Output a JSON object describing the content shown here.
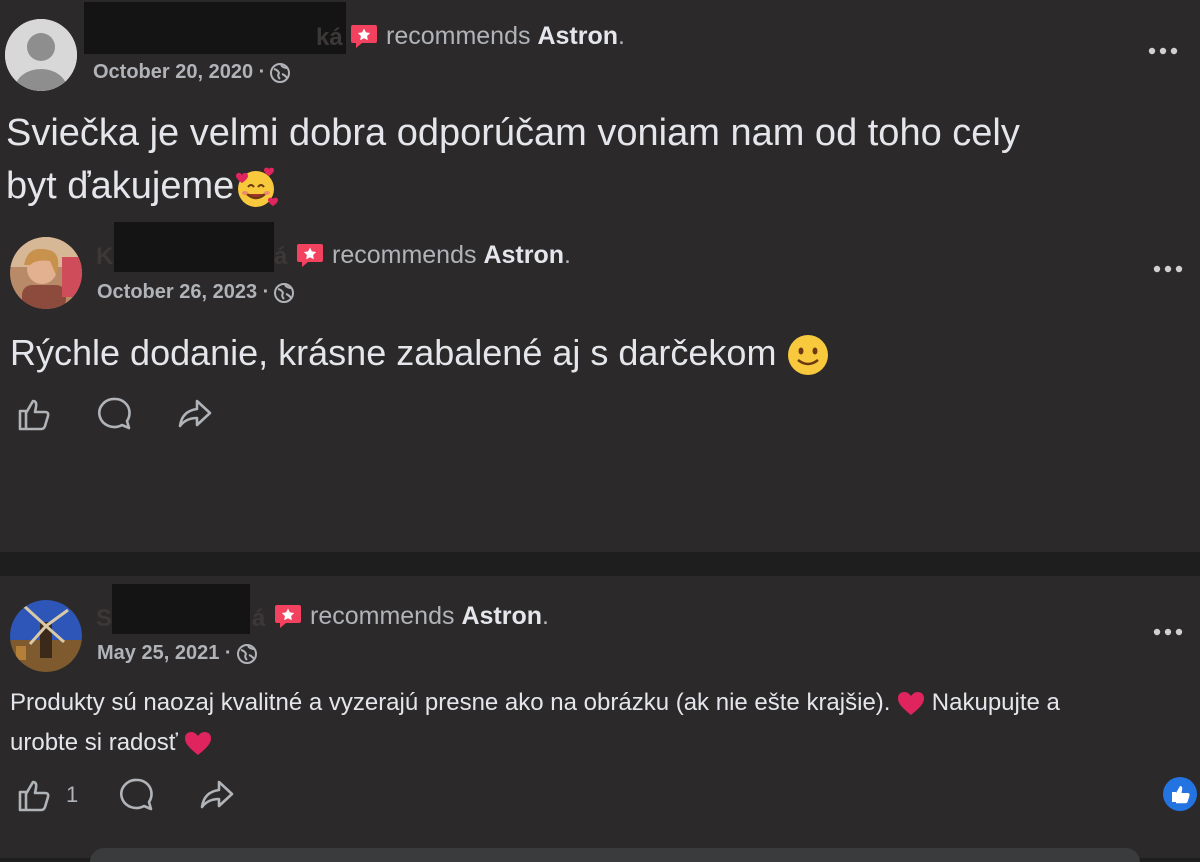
{
  "posts": [
    {
      "name_fragment": "ká",
      "recommends_text": "recommends",
      "page_name": "Astron",
      "period": ".",
      "date": "October 20, 2020 ·",
      "text_line1": "Sviečka je velmi dobra odporúčam voniam nam od toho cely",
      "text_line2": "byt ďakujeme"
    },
    {
      "name_fragment_start": "K",
      "name_fragment": "á",
      "recommends_text": "recommends",
      "page_name": "Astron",
      "period": ".",
      "date": "October 26, 2023 ·",
      "text_line1": "Rýchle dodanie, krásne zabalené aj s darčekom"
    },
    {
      "name_fragment_start": "S",
      "name_fragment": "á",
      "recommends_text": "recommends",
      "page_name": "Astron",
      "period": ".",
      "date": "May 25, 2021 ·",
      "text_line1": "Produkty sú naozaj kvalitné a vyzerajú presne ako na obrázku (ak nie ešte krajšie).",
      "text_line1b": "Nakupujte a",
      "text_line2": "urobte si radosť",
      "like_count": "1"
    }
  ],
  "colors": {
    "background": "#1e1e1e",
    "card": "#2b2929",
    "text_primary": "#e4e6eb",
    "text_secondary": "#b0b3b8",
    "recommend_red": "#f3425f",
    "like_blue": "#2374e1",
    "heart_red": "#e0245e"
  },
  "icons": [
    "recommend-star-icon",
    "globe-icon",
    "more-options-icon",
    "like-icon",
    "comment-icon",
    "share-icon",
    "heart-emoji",
    "smiling-hearts-emoji",
    "slight-smile-emoji",
    "like-reaction-icon"
  ]
}
